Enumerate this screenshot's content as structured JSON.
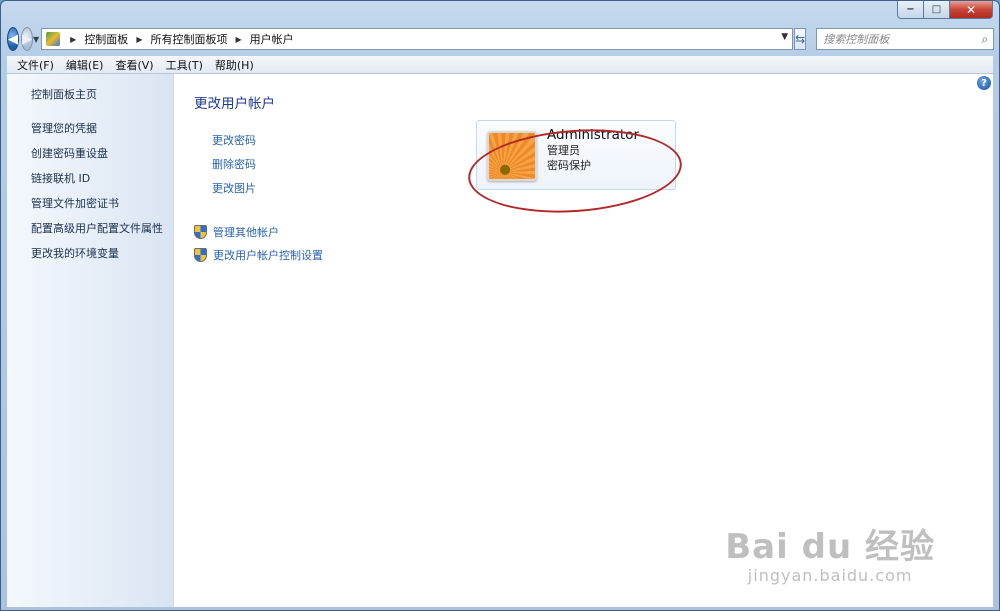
{
  "window": {
    "caption": {
      "min": "−",
      "max": "□",
      "close": "✕"
    }
  },
  "nav": {
    "breadcrumbs": [
      "控制面板",
      "所有控制面板项",
      "用户帐户"
    ],
    "search_placeholder": "搜索控制面板"
  },
  "menubar": {
    "items": [
      "文件(F)",
      "编辑(E)",
      "查看(V)",
      "工具(T)",
      "帮助(H)"
    ]
  },
  "sidebar": {
    "home": "控制面板主页",
    "links": [
      "管理您的凭据",
      "创建密码重设盘",
      "链接联机 ID",
      "管理文件加密证书",
      "配置高级用户配置文件属性",
      "更改我的环境变量"
    ]
  },
  "main": {
    "title": "更改用户帐户",
    "tasks": [
      "更改密码",
      "删除密码",
      "更改图片"
    ],
    "shield_tasks": [
      "管理其他帐户",
      "更改用户帐户控制设置"
    ]
  },
  "account": {
    "name": "Administrator",
    "role": "管理员",
    "status": "密码保护"
  },
  "watermark": {
    "top": "Bai du 经验",
    "bottom": "jingyan.baidu.com"
  },
  "colors": {
    "link": "#2a63ad",
    "title": "#1e3a8a",
    "annotation": "#b02a2a"
  }
}
